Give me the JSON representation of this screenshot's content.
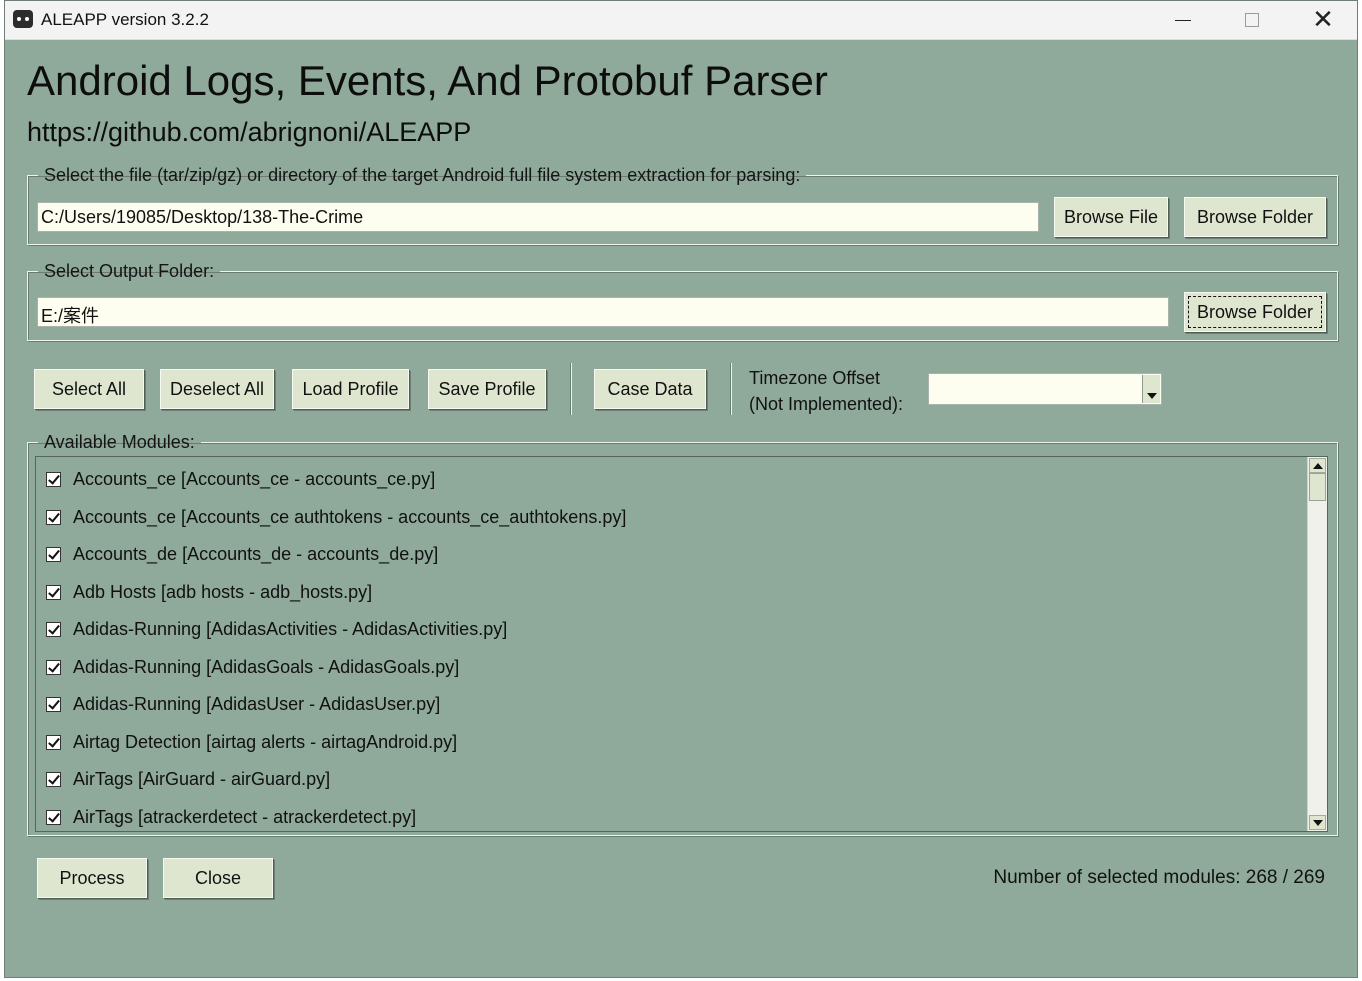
{
  "window": {
    "title": "ALEAPP version 3.2.2"
  },
  "header": {
    "title": "Android Logs, Events, And Protobuf Parser",
    "url": "https://github.com/abrignoni/ALEAPP"
  },
  "input_section": {
    "legend": "Select the file (tar/zip/gz) or directory of the target Android full file system extraction for parsing:",
    "path_value": "C:/Users/19085/Desktop/138-The-Crime",
    "browse_file_label": "Browse File",
    "browse_folder_label": "Browse Folder"
  },
  "output_section": {
    "legend": "Select Output Folder:",
    "path_value": "E:/案件",
    "browse_folder_label": "Browse Folder"
  },
  "toolbar": {
    "select_all": "Select All",
    "deselect_all": "Deselect All",
    "load_profile": "Load Profile",
    "save_profile": "Save Profile",
    "case_data": "Case Data",
    "timezone_label_line1": "Timezone Offset",
    "timezone_label_line2": "(Not Implemented):",
    "timezone_value": ""
  },
  "modules": {
    "legend": "Available Modules:",
    "items": [
      {
        "label": "Accounts_ce [Accounts_ce - accounts_ce.py]",
        "checked": true
      },
      {
        "label": "Accounts_ce [Accounts_ce authtokens - accounts_ce_authtokens.py]",
        "checked": true
      },
      {
        "label": "Accounts_de [Accounts_de - accounts_de.py]",
        "checked": true
      },
      {
        "label": "Adb Hosts [adb hosts - adb_hosts.py]",
        "checked": true
      },
      {
        "label": "Adidas-Running [AdidasActivities - AdidasActivities.py]",
        "checked": true
      },
      {
        "label": "Adidas-Running [AdidasGoals - AdidasGoals.py]",
        "checked": true
      },
      {
        "label": "Adidas-Running [AdidasUser - AdidasUser.py]",
        "checked": true
      },
      {
        "label": "Airtag Detection [airtag alerts - airtagAndroid.py]",
        "checked": true
      },
      {
        "label": "AirTags [AirGuard - airGuard.py]",
        "checked": true
      },
      {
        "label": "AirTags [atrackerdetect - atrackerdetect.py]",
        "checked": true
      }
    ]
  },
  "footer": {
    "process_label": "Process",
    "close_label": "Close",
    "selected_count_text": "Number of selected modules: 268 / 269"
  }
}
